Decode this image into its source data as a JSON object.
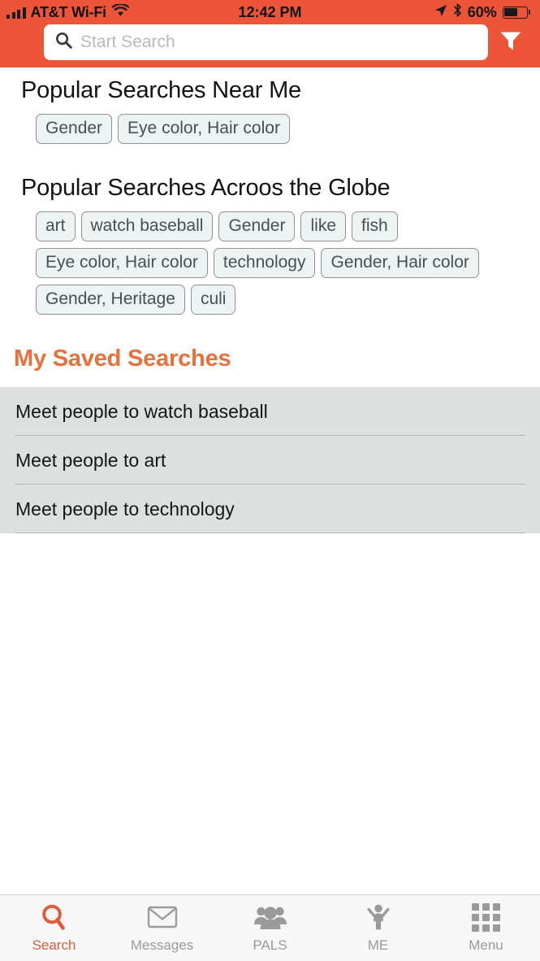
{
  "status_bar": {
    "carrier": "AT&T Wi-Fi",
    "time": "12:42 PM",
    "battery_percent": "60%",
    "battery_level": 60,
    "signal_icon": "cellular-signal-icon",
    "wifi_icon": "wifi-icon",
    "location_icon": "location-arrow-icon",
    "bluetooth_icon": "bluetooth-icon",
    "battery_icon": "battery-icon"
  },
  "header": {
    "accent_color": "#ED5539",
    "search": {
      "placeholder": "Start Search",
      "value": "",
      "icon": "search-icon"
    },
    "filter": {
      "icon": "filter-funnel-icon",
      "label": "Filter"
    }
  },
  "sections": {
    "near_me": {
      "title": "Popular Searches Near Me",
      "tags": [
        "Gender",
        "Eye color, Hair color"
      ]
    },
    "globe": {
      "title": "Popular Searches Acroos the Globe",
      "tags": [
        "art",
        "watch baseball",
        "Gender",
        "like",
        "fish",
        "Eye color, Hair color",
        "technology",
        "Gender, Hair color",
        "Gender, Heritage",
        "culi"
      ]
    },
    "saved": {
      "title": "My Saved Searches",
      "title_color": "#E8703A",
      "items": [
        "Meet people to watch baseball",
        "Meet people to art",
        "Meet people to technology"
      ]
    }
  },
  "tabbar": {
    "active_color": "#E05A3C",
    "inactive_color": "#9a9a9a",
    "tabs": [
      {
        "label": "Search",
        "icon": "search-icon",
        "active": true
      },
      {
        "label": "Messages",
        "icon": "envelope-icon",
        "active": false
      },
      {
        "label": "PALS",
        "icon": "people-group-icon",
        "active": false
      },
      {
        "label": "ME",
        "icon": "person-arms-up-icon",
        "active": false
      },
      {
        "label": "Menu",
        "icon": "grid-menu-icon",
        "active": false
      }
    ]
  }
}
